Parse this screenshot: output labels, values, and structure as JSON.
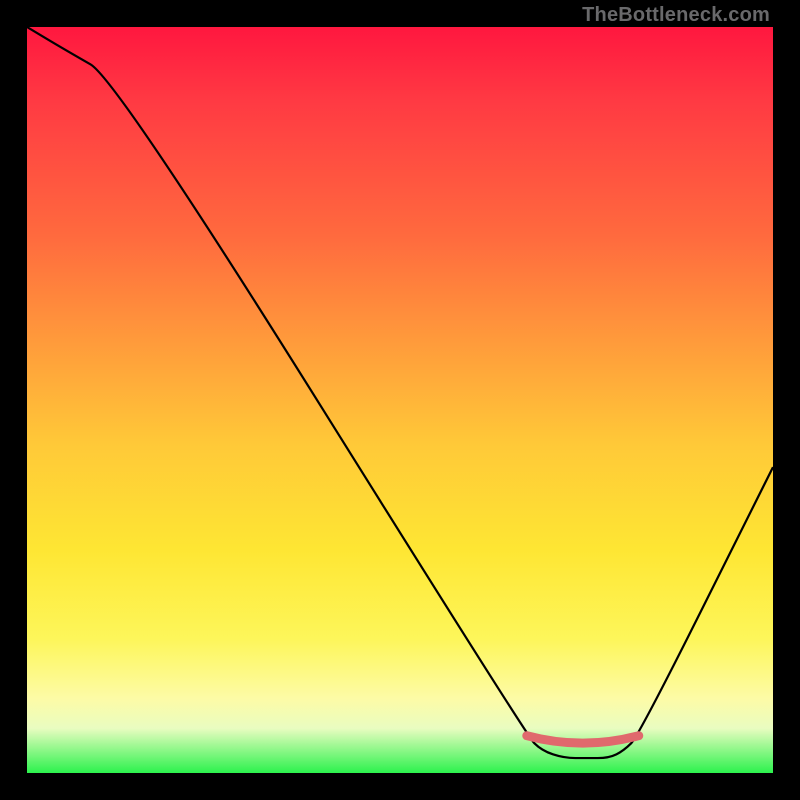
{
  "watermark": "TheBottleneck.com",
  "chart_data": {
    "type": "line",
    "title": "",
    "xlabel": "",
    "ylabel": "",
    "xlim": [
      0,
      100
    ],
    "ylim": [
      0,
      100
    ],
    "series": [
      {
        "name": "bottleneck-curve",
        "x": [
          0,
          5,
          12,
          67,
          69,
          72,
          75,
          78,
          80,
          82,
          100
        ],
        "values": [
          100,
          97,
          93,
          5,
          3,
          2,
          2,
          2,
          3,
          5,
          41
        ]
      }
    ],
    "marker_region": {
      "comment": "flat pink segment near minimum",
      "x_start": 67,
      "x_end": 82,
      "y": 3
    },
    "gradient_stops": [
      {
        "pos": 0.0,
        "color": "#ff173f"
      },
      {
        "pos": 0.1,
        "color": "#ff3a43"
      },
      {
        "pos": 0.28,
        "color": "#ff6a3e"
      },
      {
        "pos": 0.42,
        "color": "#ff9a3b"
      },
      {
        "pos": 0.56,
        "color": "#ffc938"
      },
      {
        "pos": 0.7,
        "color": "#fee633"
      },
      {
        "pos": 0.82,
        "color": "#fdf65a"
      },
      {
        "pos": 0.9,
        "color": "#fdfba6"
      },
      {
        "pos": 0.94,
        "color": "#e9fcc0"
      },
      {
        "pos": 1.0,
        "color": "#2cf24d"
      }
    ]
  }
}
